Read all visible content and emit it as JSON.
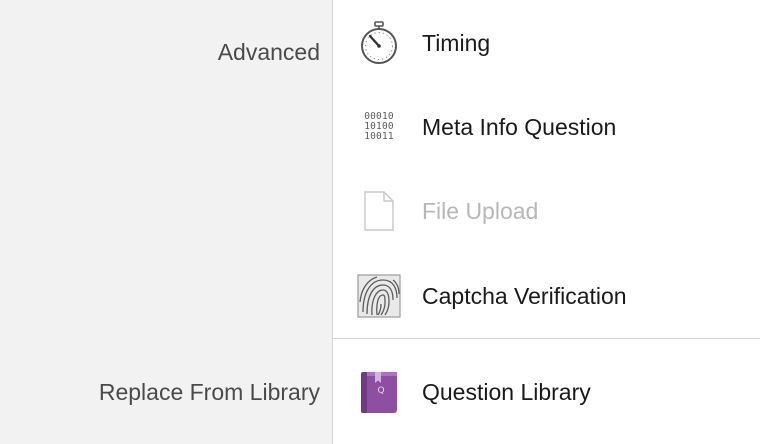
{
  "sections": {
    "advanced_label": "Advanced",
    "library_label": "Replace From Library"
  },
  "items": [
    {
      "label": "Timing",
      "icon": "stopwatch-icon",
      "enabled": true
    },
    {
      "label": "Meta Info Question",
      "icon": "binary-data-icon",
      "enabled": true,
      "icon_text": [
        "00010",
        "10100",
        "10011"
      ]
    },
    {
      "label": "File Upload",
      "icon": "document-icon",
      "enabled": false
    },
    {
      "label": "Captcha Verification",
      "icon": "fingerprint-icon",
      "enabled": true
    },
    {
      "label": "Question Library",
      "icon": "library-book-icon",
      "enabled": true
    }
  ],
  "colors": {
    "sidebar_bg": "#f2f2f2",
    "text": "#1a1a1a",
    "disabled_text": "#b7b7b7",
    "library_book": "#8e4fa2"
  }
}
